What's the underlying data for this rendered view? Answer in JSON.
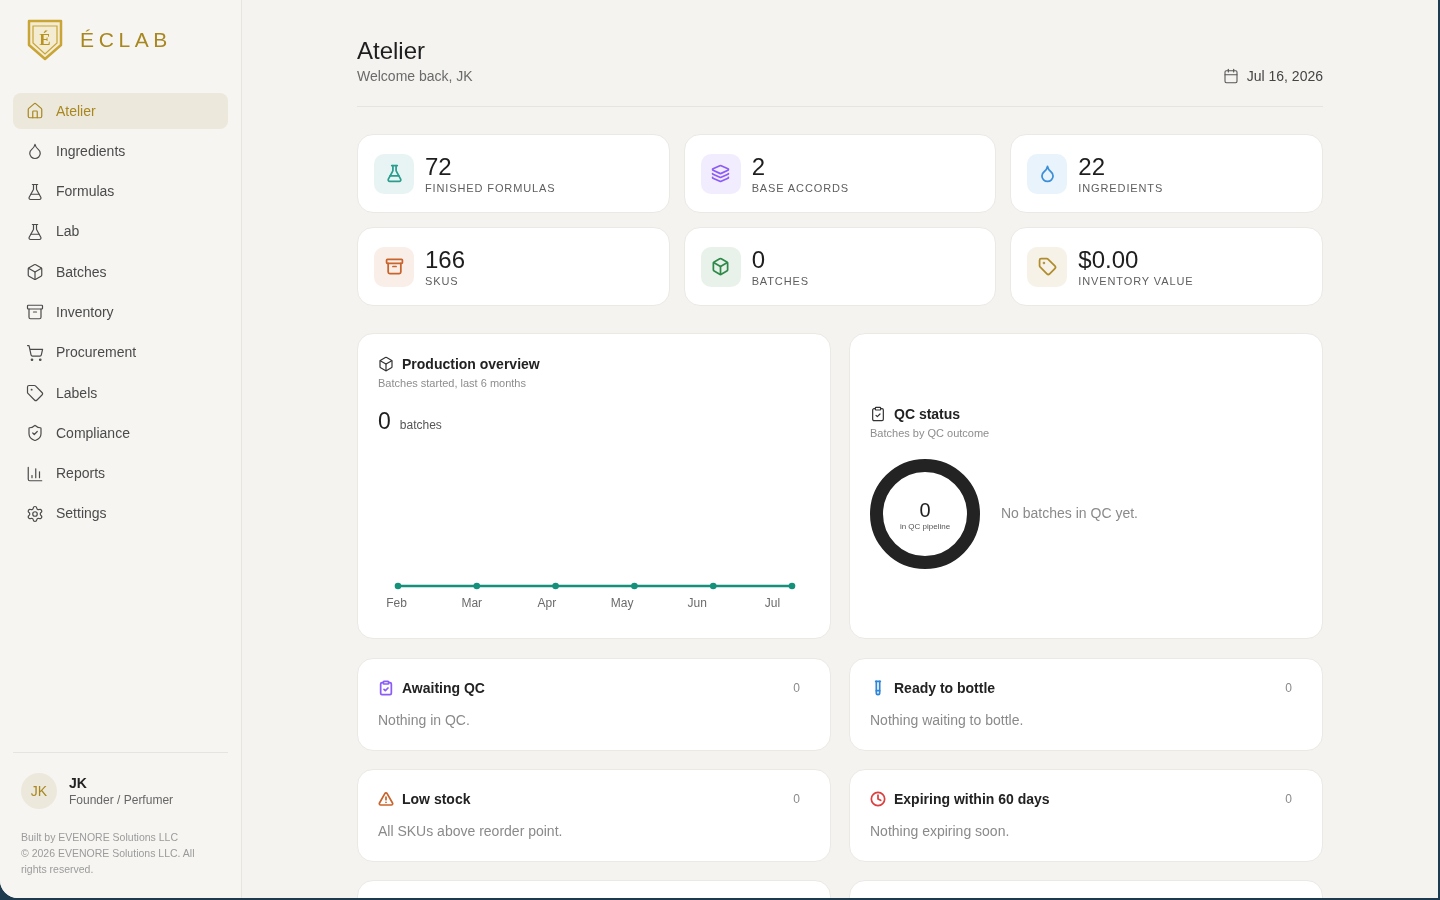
{
  "sidebar": {
    "logo_letter": "É",
    "brand": "ÉCLAB",
    "nav": [
      {
        "label": "Atelier",
        "selected": true
      },
      {
        "label": "Ingredients",
        "selected": false
      },
      {
        "label": "Formulas",
        "selected": false
      },
      {
        "label": "Lab",
        "selected": false
      },
      {
        "label": "Batches",
        "selected": false
      },
      {
        "label": "Inventory",
        "selected": false
      },
      {
        "label": "Procurement",
        "selected": false
      },
      {
        "label": "Labels",
        "selected": false
      },
      {
        "label": "Compliance",
        "selected": false
      },
      {
        "label": "Reports",
        "selected": false
      },
      {
        "label": "Settings",
        "selected": false
      }
    ],
    "user": {
      "initials": "JK",
      "name": "JK",
      "role": "Founder / Perfumer"
    },
    "footer": {
      "built_by": "Built by EVENORE Solutions LLC",
      "copyright": "© 2026 EVENORE Solutions LLC. All rights reserved."
    }
  },
  "header": {
    "title": "Atelier",
    "subtitle": "Welcome back, JK",
    "date": "Jul 16, 2026"
  },
  "stats": [
    {
      "value": "72",
      "label": "FINISHED FORMULAS",
      "color": "#2a9d8f"
    },
    {
      "value": "2",
      "label": "BASE ACCORDS",
      "color": "#8b5cf6"
    },
    {
      "value": "22",
      "label": "INGREDIENTS",
      "color": "#3b8fd9"
    },
    {
      "value": "166",
      "label": "SKUS",
      "color": "#c8642c"
    },
    {
      "value": "0",
      "label": "BATCHES",
      "color": "#2f8a4a"
    },
    {
      "value": "$0.00",
      "label": "INVENTORY VALUE",
      "color": "#b08d2c"
    }
  ],
  "production": {
    "title": "Production overview",
    "subtitle": "Batches started, last 6 months",
    "total": "0",
    "unit": "batches",
    "months": [
      "Feb",
      "Mar",
      "Apr",
      "May",
      "Jun",
      "Jul"
    ]
  },
  "qc": {
    "title": "QC status",
    "subtitle": "Batches by QC outcome",
    "total": "0",
    "total_label": "in QC pipeline",
    "empty_message": "No batches in QC yet."
  },
  "queues": [
    {
      "title": "Awaiting QC",
      "count": "0",
      "message": "Nothing in QC.",
      "color": "#8b5cf6"
    },
    {
      "title": "Ready to bottle",
      "count": "0",
      "message": "Nothing waiting to bottle.",
      "color": "#2f86d6"
    },
    {
      "title": "Low stock",
      "count": "0",
      "message": "All SKUs above reorder point.",
      "color": "#c8642c"
    },
    {
      "title": "Expiring within 60 days",
      "count": "0",
      "message": "Nothing expiring soon.",
      "color": "#dc3f3f"
    }
  ]
}
